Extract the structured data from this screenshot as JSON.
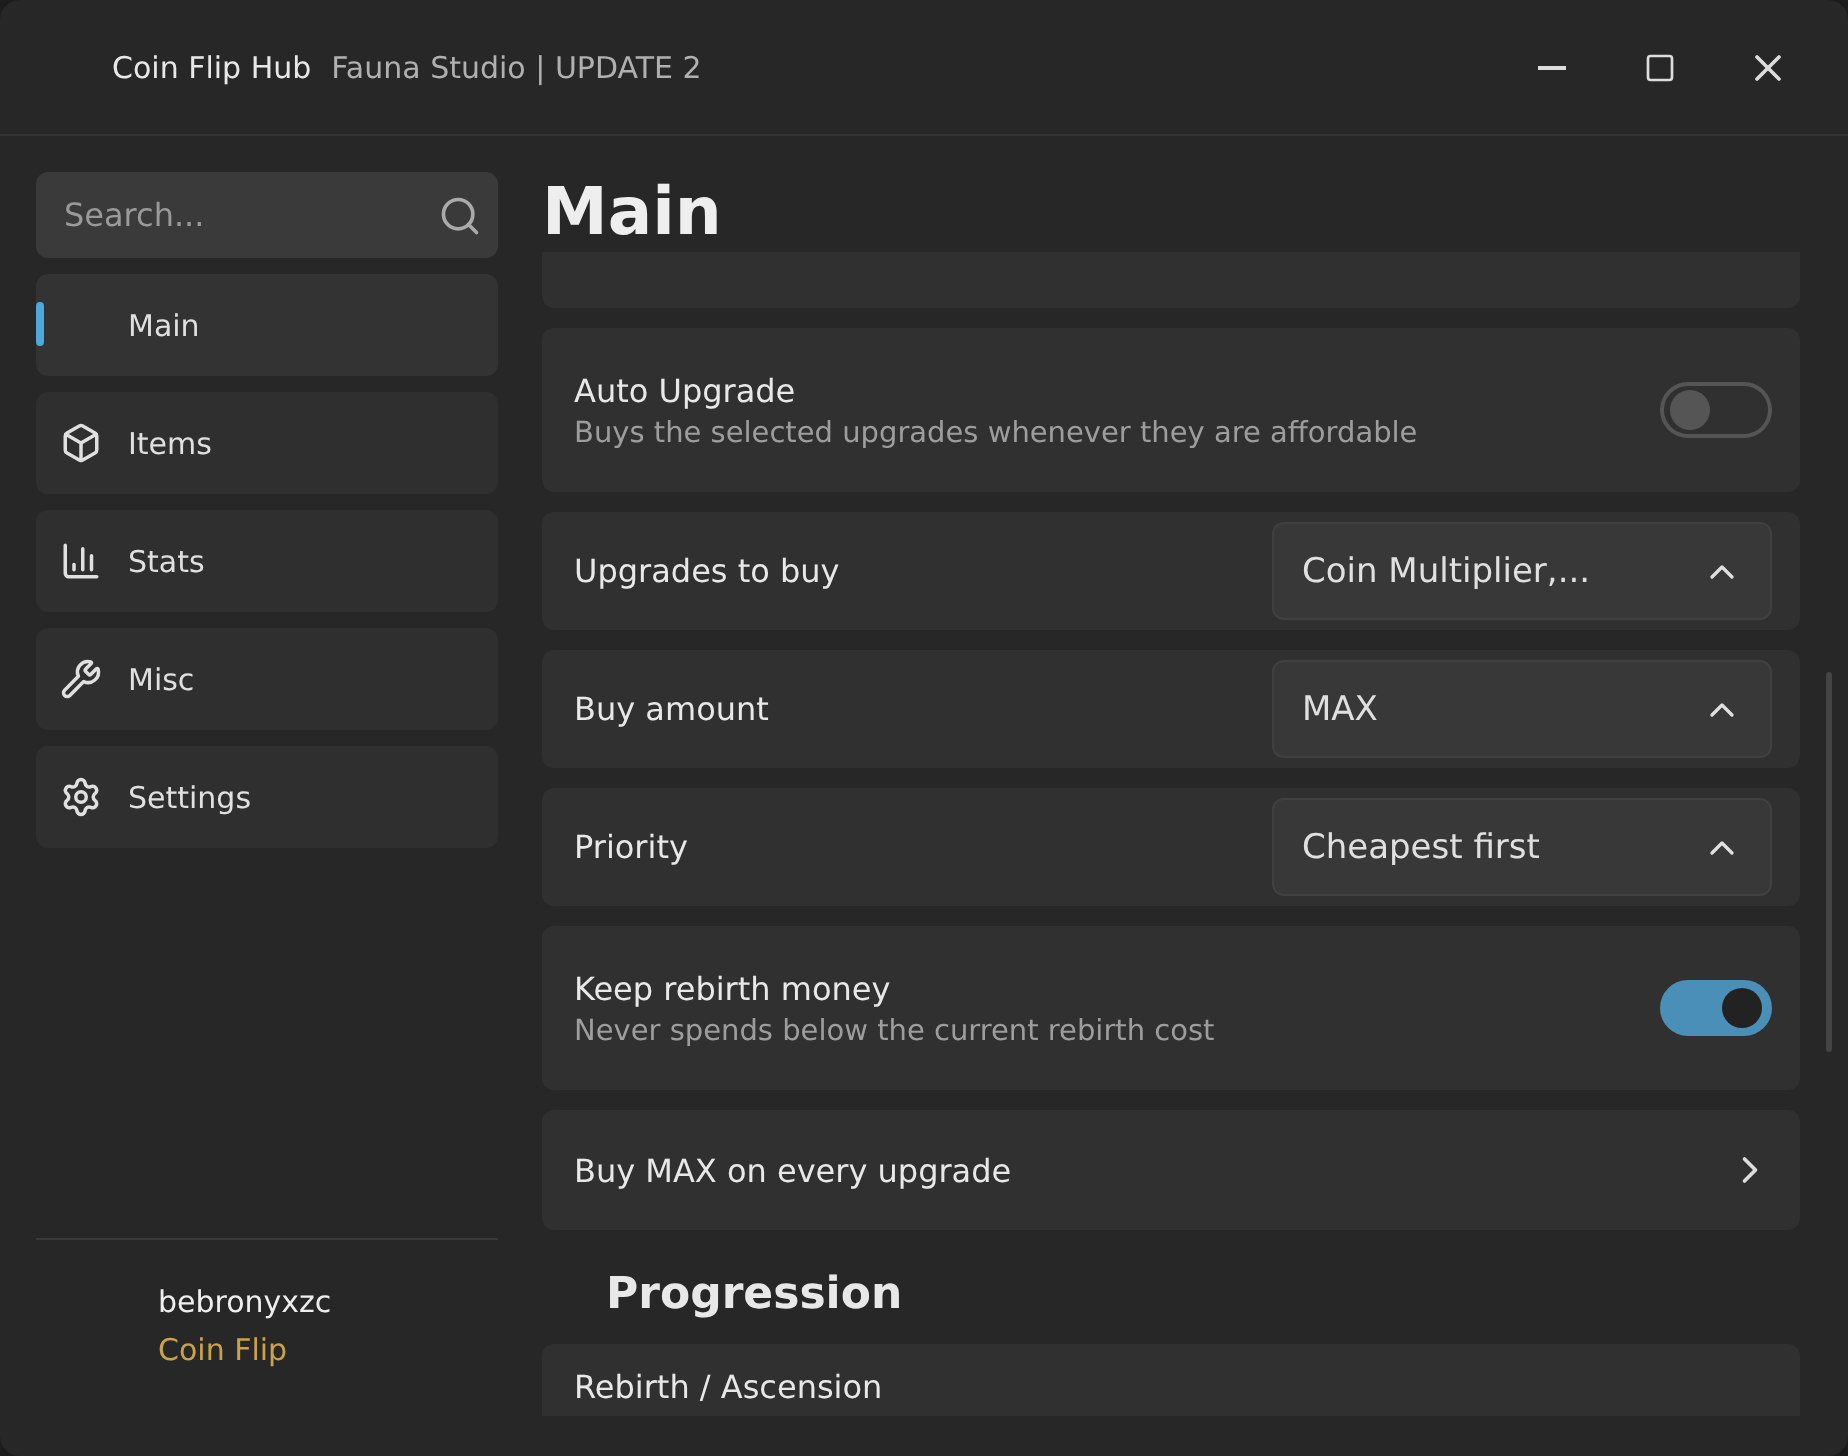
{
  "window": {
    "title": "Coin Flip Hub",
    "subtitle": "Fauna Studio | UPDATE 2"
  },
  "sidebar": {
    "search": {
      "placeholder": "Search..."
    },
    "items": [
      {
        "label": "Main",
        "selected": true
      },
      {
        "label": "Items",
        "selected": false
      },
      {
        "label": "Stats",
        "selected": false
      },
      {
        "label": "Misc",
        "selected": false
      },
      {
        "label": "Settings",
        "selected": false
      }
    ],
    "user": {
      "name": "bebronyxzc",
      "game": "Coin Flip"
    }
  },
  "page": {
    "title": "Main",
    "rows": [
      {
        "kind": "toggle",
        "label": "Auto Upgrade",
        "description": "Buys the selected upgrades whenever they are affordable",
        "on": false
      },
      {
        "kind": "dropdown",
        "label": "Upgrades to buy",
        "value": "Coin Multiplier,..."
      },
      {
        "kind": "dropdown",
        "label": "Buy amount",
        "value": "MAX"
      },
      {
        "kind": "dropdown",
        "label": "Priority",
        "value": "Cheapest first"
      },
      {
        "kind": "toggle",
        "label": "Keep rebirth money",
        "description": "Never spends below the current rebirth cost",
        "on": true
      },
      {
        "kind": "link",
        "label": "Buy MAX on every upgrade"
      }
    ],
    "section": "Progression",
    "section_rows": [
      {
        "kind": "link",
        "label": "Rebirth / Ascension"
      }
    ]
  }
}
